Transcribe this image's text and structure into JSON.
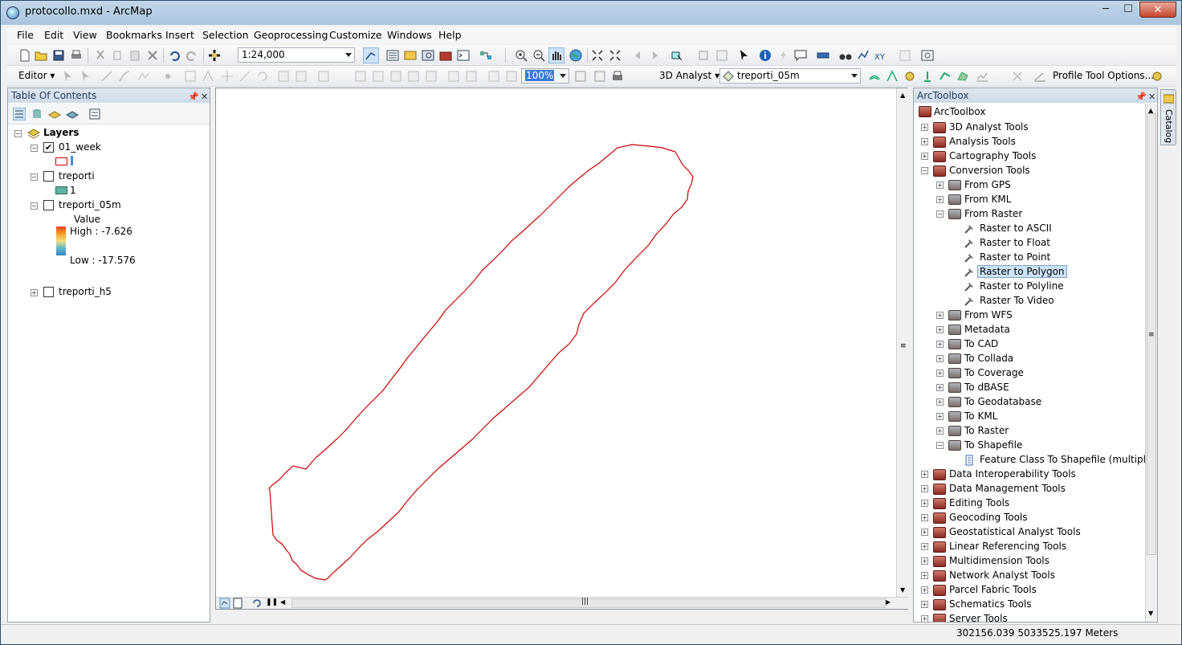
{
  "window": {
    "title": "protocollo.mxd - ArcMap",
    "minimize": "─",
    "maximize": "☐",
    "close": "✕"
  },
  "menu": [
    "File",
    "Edit",
    "View",
    "Bookmarks",
    "Insert",
    "Selection",
    "Geoprocessing",
    "Customize",
    "Windows",
    "Help"
  ],
  "toolbar": {
    "scale": "1:24,000",
    "editor_label": "Editor",
    "zoom_percent": "100%",
    "analyst_label": "3D Analyst",
    "layer_combo": "treporti_05m",
    "profile_label": "Profile Tool Options..."
  },
  "toc": {
    "title": "Table Of Contents",
    "root": "Layers",
    "layers": [
      {
        "name": "01_week",
        "checked": true,
        "expanded": true
      },
      {
        "name": "treporti",
        "checked": false,
        "expanded": true,
        "legend_label": "1"
      },
      {
        "name": "treporti_05m",
        "checked": false,
        "expanded": true,
        "value_label": "Value",
        "high": "High : -7.626",
        "low": "Low : -17.576"
      },
      {
        "name": "treporti_h5",
        "checked": false,
        "expanded": false
      }
    ]
  },
  "toolbox": {
    "title": "ArcToolbox",
    "root": "ArcToolbox",
    "items": [
      {
        "label": "3D Analyst Tools",
        "level": 0,
        "type": "toolbox",
        "exp": "+"
      },
      {
        "label": "Analysis Tools",
        "level": 0,
        "type": "toolbox",
        "exp": "+"
      },
      {
        "label": "Cartography Tools",
        "level": 0,
        "type": "toolbox",
        "exp": "+"
      },
      {
        "label": "Conversion Tools",
        "level": 0,
        "type": "toolbox",
        "exp": "−"
      },
      {
        "label": "From GPS",
        "level": 1,
        "type": "toolset",
        "exp": "+"
      },
      {
        "label": "From KML",
        "level": 1,
        "type": "toolset",
        "exp": "+"
      },
      {
        "label": "From Raster",
        "level": 1,
        "type": "toolset",
        "exp": "−"
      },
      {
        "label": "Raster to ASCII",
        "level": 2,
        "type": "tool",
        "exp": ""
      },
      {
        "label": "Raster to Float",
        "level": 2,
        "type": "tool",
        "exp": ""
      },
      {
        "label": "Raster to Point",
        "level": 2,
        "type": "tool",
        "exp": ""
      },
      {
        "label": "Raster to Polygon",
        "level": 2,
        "type": "tool",
        "exp": "",
        "selected": true
      },
      {
        "label": "Raster to Polyline",
        "level": 2,
        "type": "tool",
        "exp": ""
      },
      {
        "label": "Raster To Video",
        "level": 2,
        "type": "tool",
        "exp": ""
      },
      {
        "label": "From WFS",
        "level": 1,
        "type": "toolset",
        "exp": "+"
      },
      {
        "label": "Metadata",
        "level": 1,
        "type": "toolset",
        "exp": "+"
      },
      {
        "label": "To CAD",
        "level": 1,
        "type": "toolset",
        "exp": "+"
      },
      {
        "label": "To Collada",
        "level": 1,
        "type": "toolset",
        "exp": "+"
      },
      {
        "label": "To Coverage",
        "level": 1,
        "type": "toolset",
        "exp": "+"
      },
      {
        "label": "To dBASE",
        "level": 1,
        "type": "toolset",
        "exp": "+"
      },
      {
        "label": "To Geodatabase",
        "level": 1,
        "type": "toolset",
        "exp": "+"
      },
      {
        "label": "To KML",
        "level": 1,
        "type": "toolset",
        "exp": "+"
      },
      {
        "label": "To Raster",
        "level": 1,
        "type": "toolset",
        "exp": "+"
      },
      {
        "label": "To Shapefile",
        "level": 1,
        "type": "toolset",
        "exp": "−"
      },
      {
        "label": "Feature Class To Shapefile (multiple)",
        "level": 2,
        "type": "script",
        "exp": ""
      },
      {
        "label": "Data Interoperability Tools",
        "level": 0,
        "type": "toolbox",
        "exp": "+"
      },
      {
        "label": "Data Management Tools",
        "level": 0,
        "type": "toolbox",
        "exp": "+"
      },
      {
        "label": "Editing Tools",
        "level": 0,
        "type": "toolbox",
        "exp": "+"
      },
      {
        "label": "Geocoding Tools",
        "level": 0,
        "type": "toolbox",
        "exp": "+"
      },
      {
        "label": "Geostatistical Analyst Tools",
        "level": 0,
        "type": "toolbox",
        "exp": "+"
      },
      {
        "label": "Linear Referencing Tools",
        "level": 0,
        "type": "toolbox",
        "exp": "+"
      },
      {
        "label": "Multidimension Tools",
        "level": 0,
        "type": "toolbox",
        "exp": "+"
      },
      {
        "label": "Network Analyst Tools",
        "level": 0,
        "type": "toolbox",
        "exp": "+"
      },
      {
        "label": "Parcel Fabric Tools",
        "level": 0,
        "type": "toolbox",
        "exp": "+"
      },
      {
        "label": "Schematics Tools",
        "level": 0,
        "type": "toolbox",
        "exp": "+"
      },
      {
        "label": "Server Tools",
        "level": 0,
        "type": "toolbox",
        "exp": "+"
      }
    ]
  },
  "catalog_tab": "Catalog",
  "status": {
    "coords": "302156.039  5033525.197 Meters"
  },
  "colors": {
    "polygon_outline": "#cc0000",
    "selection": "#cce4f7",
    "legend_fill": "#5fb3a0"
  }
}
